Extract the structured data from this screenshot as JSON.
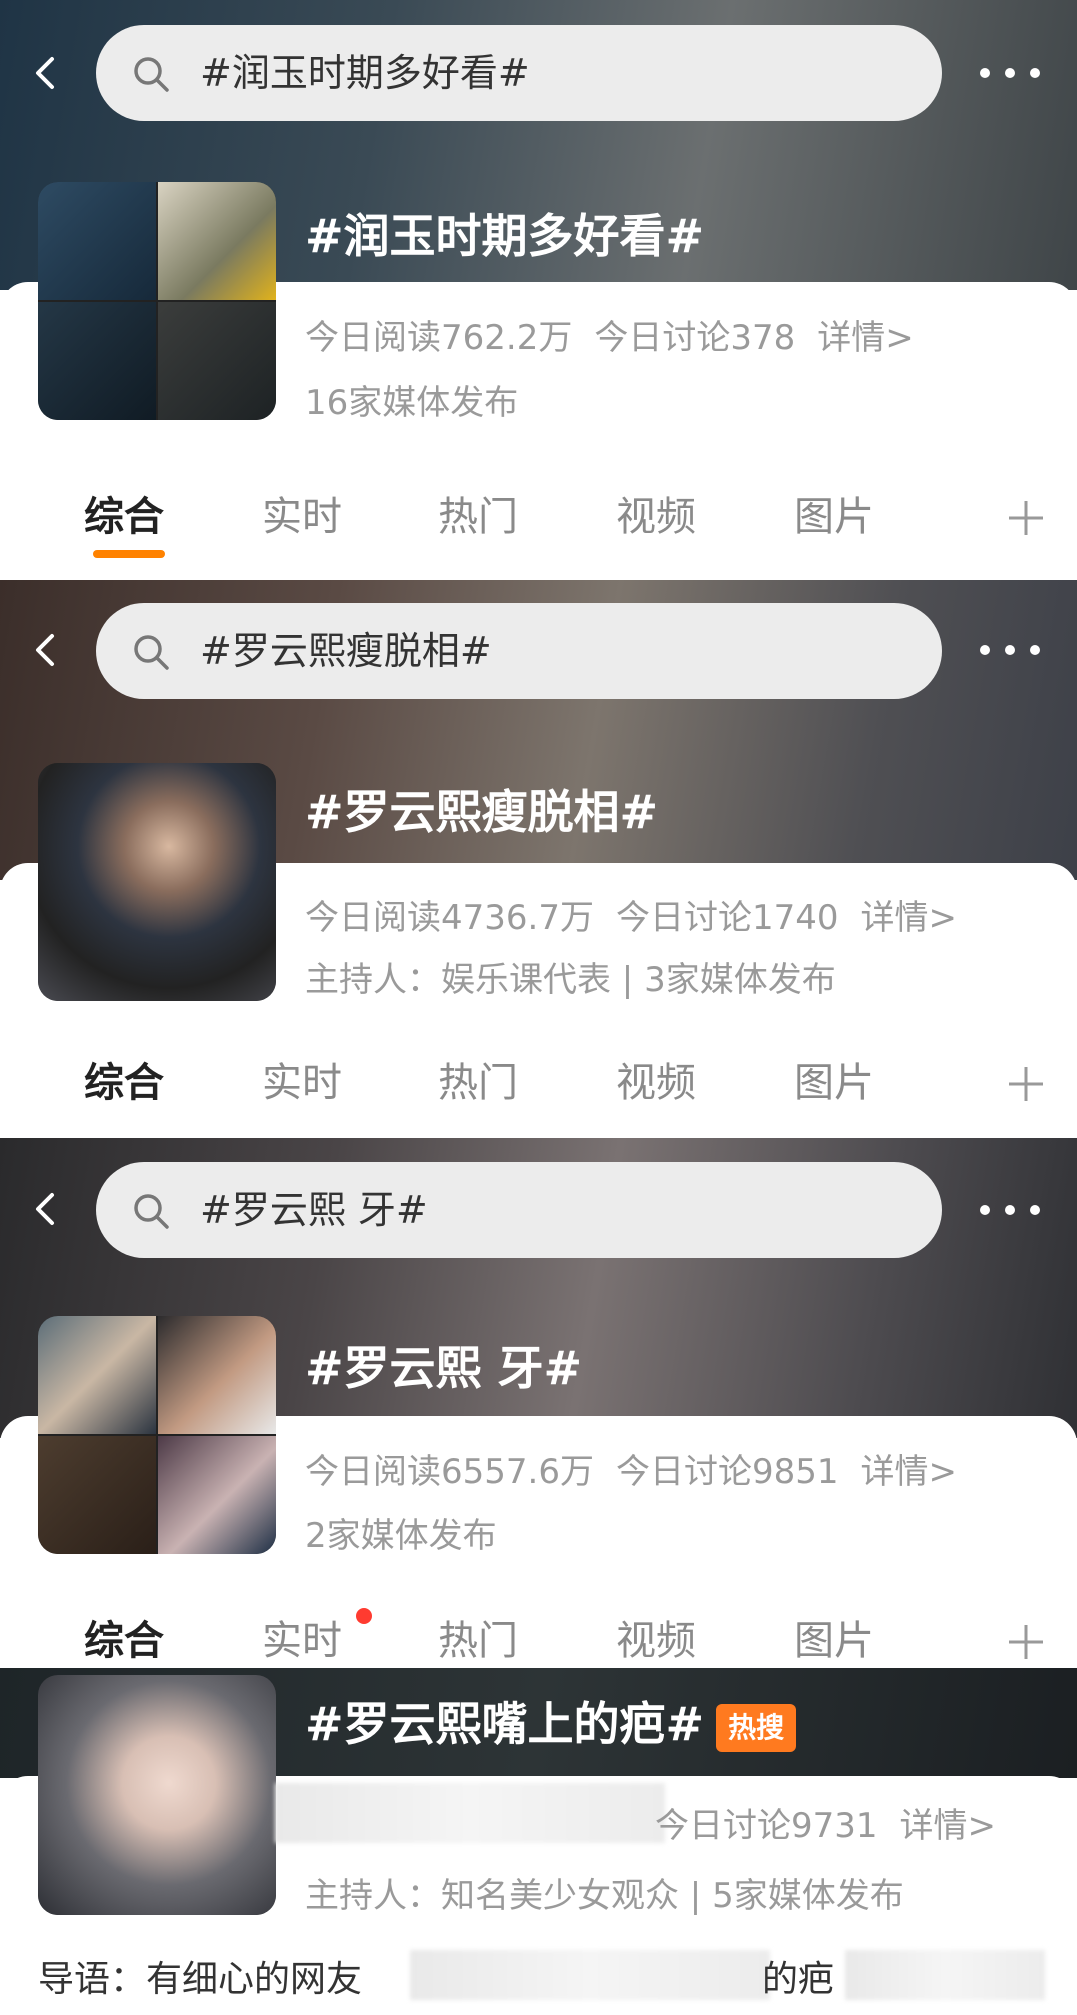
{
  "screens": [
    {
      "search": "#润玉时期多好看#",
      "title": "#润玉时期多好看#",
      "read": "今日阅读762.2万",
      "discuss": "今日讨论378",
      "detail": "详情>",
      "sub": "16家媒体发布"
    },
    {
      "search": "#罗云熙瘦脱相#",
      "title": "#罗云熙瘦脱相#",
      "read": "今日阅读4736.7万",
      "discuss": "今日讨论1740",
      "detail": "详情>",
      "sub": "主持人：娱乐课代表 | 3家媒体发布"
    },
    {
      "search": "#罗云熙 牙#",
      "title": "#罗云熙 牙#",
      "read": "今日阅读6557.6万",
      "discuss": "今日讨论9851",
      "detail": "详情>",
      "sub": "2家媒体发布"
    }
  ],
  "tabs": [
    "综合",
    "实时",
    "热门",
    "视频",
    "图片"
  ],
  "fourth": {
    "title": "#罗云熙嘴上的疤#",
    "badge": "热搜",
    "discuss": "今日讨论9731",
    "detail": "详情>",
    "sub": "主持人：知名美少女观众 | 5家媒体发布",
    "intro_start": "导语：有细心的网友",
    "intro_end": "的疤"
  },
  "colors": {
    "accent": "#ff8200",
    "badge": "#ff7a1f",
    "dot": "#ff3b30"
  }
}
